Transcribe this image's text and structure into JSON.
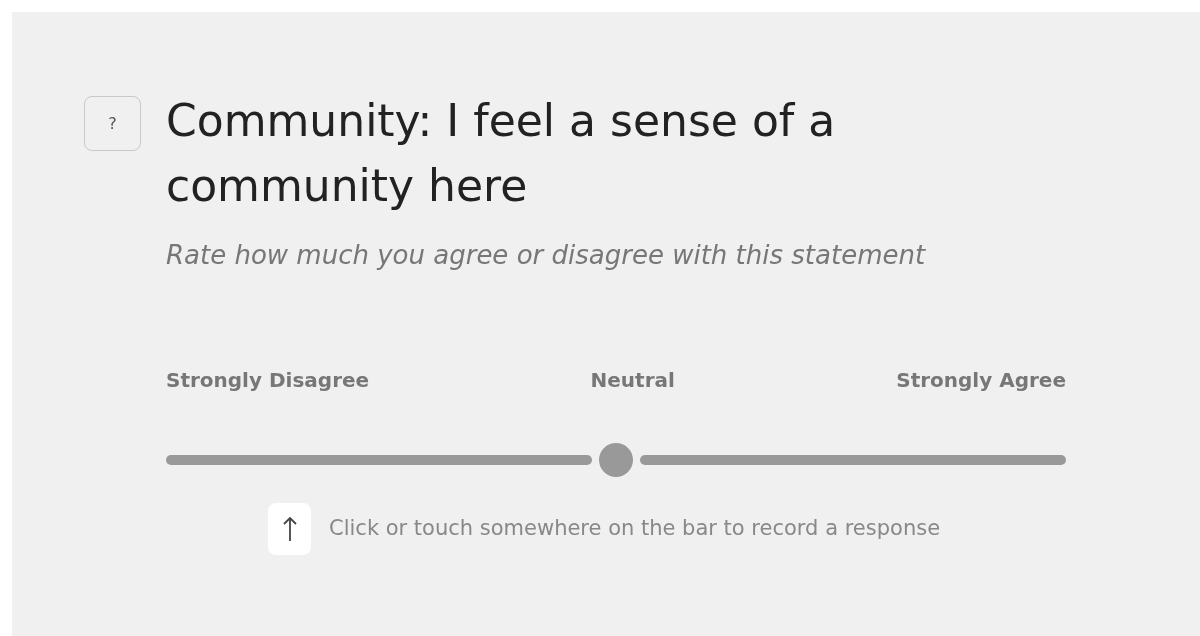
{
  "help_button": {
    "label": "?"
  },
  "question": {
    "title": "Community: I feel a sense of a community here",
    "instruction": "Rate how much you agree or disagree with this statement"
  },
  "scale": {
    "labels": [
      "Strongly Disagree",
      "Neutral",
      "Strongly Agree"
    ],
    "level": 0.5
  },
  "hint": {
    "text": "Click or touch somewhere on the bar to record a response"
  }
}
